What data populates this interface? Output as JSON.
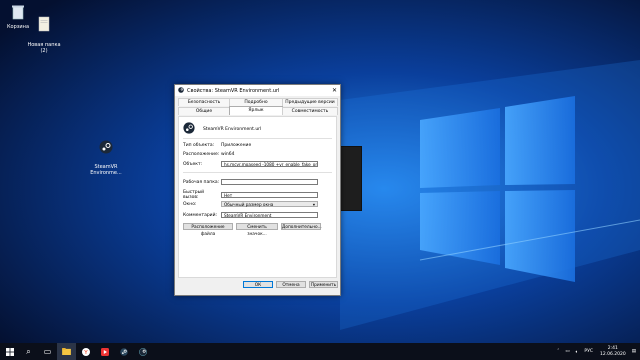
{
  "desktop": {
    "icons": [
      {
        "label": "Корзина"
      },
      {
        "label": "Новая папка\n(2)"
      },
      {
        "label": "SteamVR\nEnvironme..."
      }
    ]
  },
  "dialog": {
    "title": "Свойства: SteamVR Environment.url",
    "tabs": {
      "security": "Безопасность",
      "details": "Подробно",
      "previous": "Предыдущие версии",
      "general": "Общие",
      "shortcut": "Ярлык",
      "compat": "Совместимость"
    },
    "name": "SteamVR Environment.url",
    "fields": {
      "type_label": "Тип объекта:",
      "type_value": "Приложение",
      "location_label": "Расположение:",
      "location_value": "win64",
      "target_label": "Объект:",
      "target_value": "hs.mcvr.moaseed -1080 +vr_enable_fake_or_test",
      "start_label": "Рабочая папка:",
      "start_value": "",
      "hotkey_label": "Быстрый вызов:",
      "hotkey_value": "Нет",
      "window_label": "Окно:",
      "window_value": "Обычный размер окна",
      "comment_label": "Комментарий:",
      "comment_value": "SteamVR Environment"
    },
    "buttons": {
      "open_location": "Расположение файла",
      "change_icon": "Сменить значок...",
      "advanced": "Дополнительно...",
      "ok": "ОК",
      "cancel": "Отмена",
      "apply": "Применить"
    }
  },
  "taskbar": {
    "language": "РУС",
    "time": "2:41",
    "date": "12.06.2020"
  },
  "colors": {
    "accent": "#0078d7",
    "taskbar": "#0b0f1a"
  }
}
